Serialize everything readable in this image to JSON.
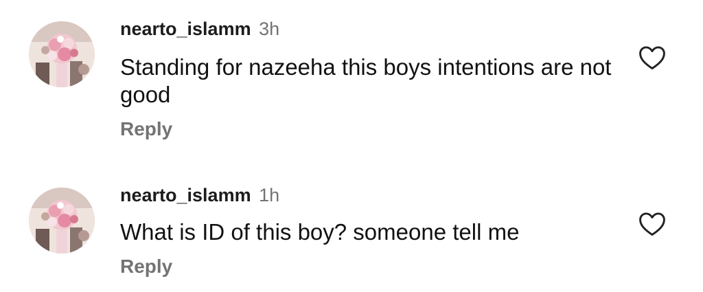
{
  "comments": [
    {
      "username": "nearto_islamm",
      "time": "3h",
      "text": "Standing for nazeeha this boys intentions are not good",
      "reply_label": "Reply",
      "like_icon": "heart-outline-icon"
    },
    {
      "username": "nearto_islamm",
      "time": "1h",
      "text": "What is ID of this boy? someone tell me",
      "reply_label": "Reply",
      "like_icon": "heart-outline-icon"
    }
  ],
  "colors": {
    "text": "#111111",
    "secondary": "#737373",
    "background": "#ffffff"
  }
}
